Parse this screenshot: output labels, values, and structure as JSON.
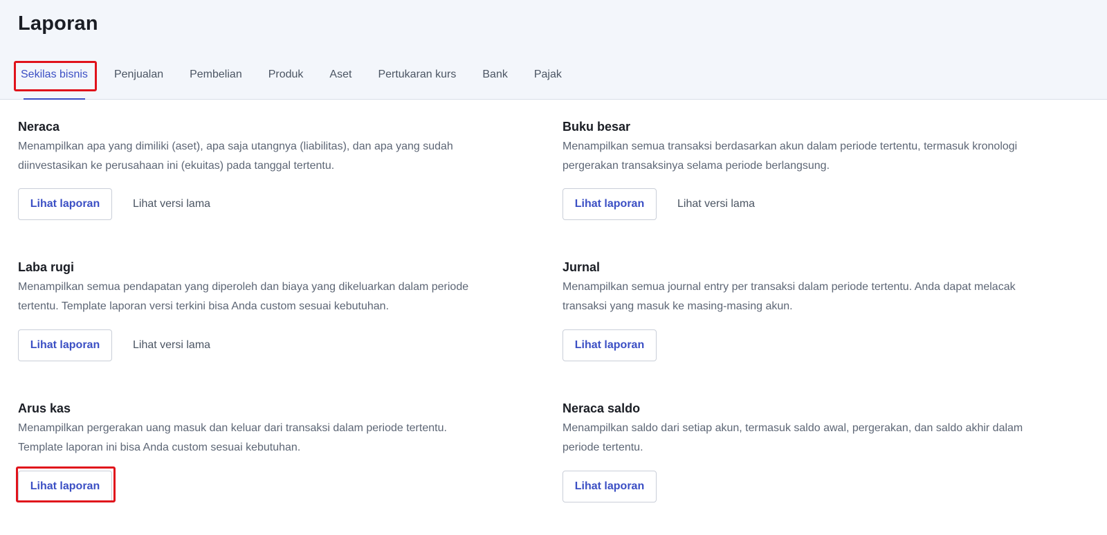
{
  "header": {
    "title": "Laporan"
  },
  "tabs": [
    {
      "label": "Sekilas bisnis",
      "active": true
    },
    {
      "label": "Penjualan"
    },
    {
      "label": "Pembelian"
    },
    {
      "label": "Produk"
    },
    {
      "label": "Aset"
    },
    {
      "label": "Pertukaran kurs"
    },
    {
      "label": "Bank"
    },
    {
      "label": "Pajak"
    }
  ],
  "reports": [
    {
      "title": "Neraca",
      "desc_line1": "Menampilkan apa yang dimiliki (aset), apa saja utangnya (liabilitas), dan apa yang sudah",
      "desc_line2": "diinvestasikan ke perusahaan ini (ekuitas) pada tanggal tertentu.",
      "view_label": "Lihat laporan",
      "old_label": "Lihat versi lama"
    },
    {
      "title": "Buku besar",
      "desc_line1": "Menampilkan semua transaksi berdasarkan akun dalam periode tertentu, termasuk kronologi",
      "desc_line2": "pergerakan transaksinya selama periode berlangsung.",
      "view_label": "Lihat laporan",
      "old_label": "Lihat versi lama"
    },
    {
      "title": "Laba rugi",
      "desc_line1": "Menampilkan semua pendapatan yang diperoleh dan biaya yang dikeluarkan dalam periode",
      "desc_line2": "tertentu. Template laporan versi terkini bisa Anda custom sesuai kebutuhan.",
      "view_label": "Lihat laporan",
      "old_label": "Lihat versi lama"
    },
    {
      "title": "Jurnal",
      "desc_line1": "Menampilkan semua journal entry per transaksi dalam periode tertentu. Anda dapat melacak",
      "desc_line2": "transaksi yang masuk ke masing-masing akun.",
      "view_label": "Lihat laporan"
    },
    {
      "title": "Arus kas",
      "desc_line1": "Menampilkan pergerakan uang masuk dan keluar dari transaksi dalam periode tertentu.",
      "desc_line2": "Template laporan ini bisa Anda custom sesuai kebutuhan.",
      "view_label": "Lihat laporan"
    },
    {
      "title": "Neraca saldo",
      "desc_line1": "Menampilkan saldo dari setiap akun, termasuk saldo awal, pergerakan, dan saldo akhir dalam",
      "desc_line2": "periode tertentu.",
      "view_label": "Lihat laporan"
    }
  ],
  "colors": {
    "accent": "#3b4fc4",
    "highlight": "#e0121b",
    "header_bg": "#f3f6fb"
  }
}
